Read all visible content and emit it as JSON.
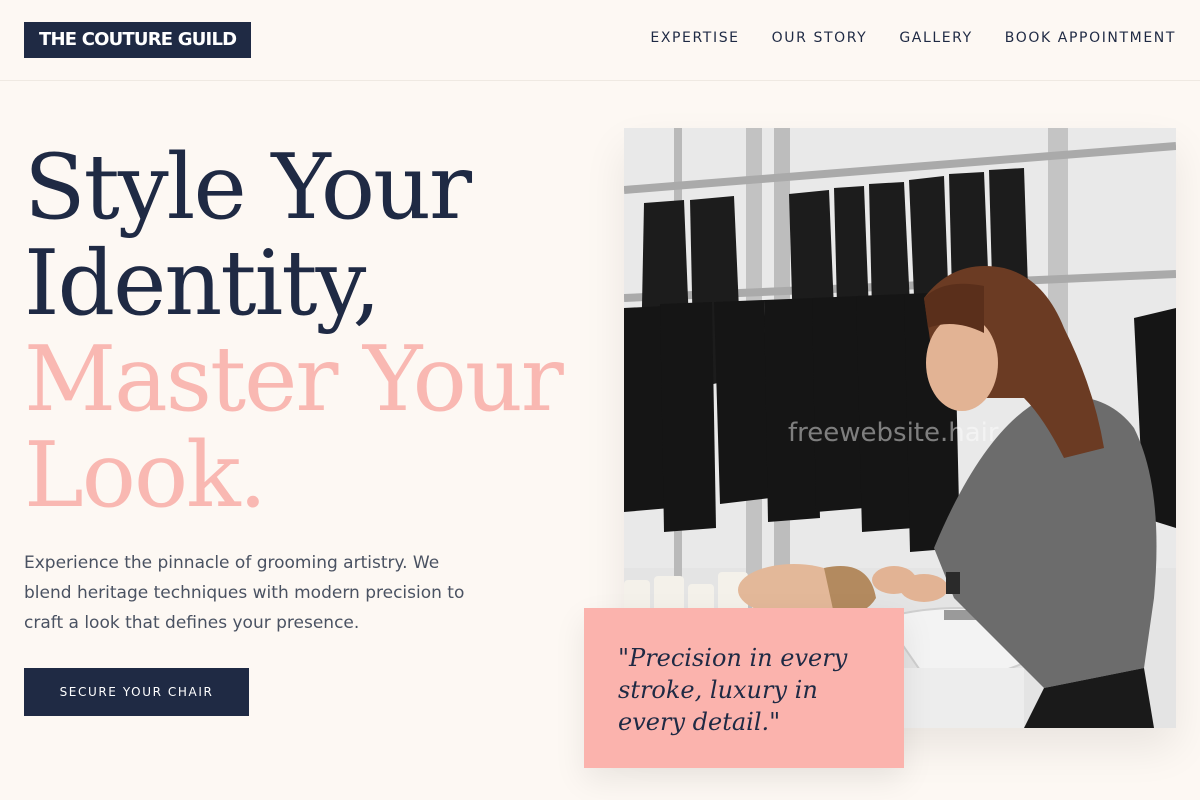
{
  "brand": {
    "name": "THE COUTURE GUILD"
  },
  "nav": {
    "items": [
      "EXPERTISE",
      "OUR STORY",
      "GALLERY",
      "BOOK APPOINTMENT"
    ]
  },
  "hero": {
    "headline_lines": [
      "Style Your",
      "Identity,",
      "Master Your",
      "Look."
    ],
    "lead": "Experience the pinnacle of grooming artistry. We blend heritage techniques with modern precision to craft a look that defines your presence.",
    "cta_label": "SECURE YOUR CHAIR"
  },
  "photo": {
    "watermark": "freewebsite.hair"
  },
  "quote": {
    "text": "\"Precision in every stroke, luxury in every detail.\""
  },
  "colors": {
    "navy": "#1f2a44",
    "pink": "#f9b8b2",
    "quote_bg": "#fbb3ad",
    "page_bg": "#fdf8f3"
  }
}
